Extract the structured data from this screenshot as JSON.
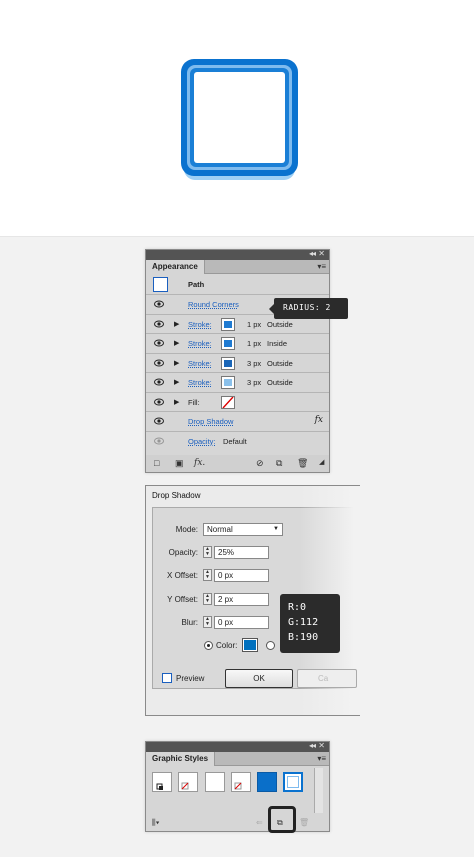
{
  "appearance": {
    "tab_title": "Appearance",
    "path_label": "Path",
    "rows": [
      {
        "label": "Round Corners",
        "kind": "effect"
      },
      {
        "label": "Stroke:",
        "weight": "1 px",
        "align": "Outside",
        "color": "#1f7ad1"
      },
      {
        "label": "Stroke:",
        "weight": "1 px",
        "align": "Inside",
        "color": "#1f7ad1"
      },
      {
        "label": "Stroke:",
        "weight": "3 px",
        "align": "Outside",
        "color": "#1a66b8"
      },
      {
        "label": "Stroke:",
        "weight": "3 px",
        "align": "Outside",
        "color": "#8ac0ea"
      },
      {
        "label": "Fill:",
        "kind": "fill-none"
      },
      {
        "label": "Drop Shadow",
        "kind": "effect",
        "fx": "fx"
      },
      {
        "label": "Opacity:",
        "value": "Default"
      }
    ],
    "toolbar_fx": "fx."
  },
  "radius_tooltip": "RADIUS: 2",
  "drop_shadow": {
    "title": "Drop Shadow",
    "mode_label": "Mode:",
    "mode_value": "Normal",
    "opacity_label": "Opacity:",
    "opacity_value": "25%",
    "x_offset_label": "X Offset:",
    "x_offset_value": "0 px",
    "y_offset_label": "Y Offset:",
    "y_offset_value": "2 px",
    "blur_label": "Blur:",
    "blur_value": "0 px",
    "color_label": "Color:",
    "shadow_color": "#0070be",
    "preview_label": "Preview",
    "ok_label": "OK",
    "cancel_label": "Ca"
  },
  "rgb_tooltip": {
    "r": "R:0",
    "g": "G:112",
    "b": "B:190"
  },
  "graphic_styles": {
    "tab_title": "Graphic Styles",
    "highlighted_icon": "new-graphic-style-icon"
  },
  "colors": {
    "accent": "#1a5fbf",
    "shape_blue": "#0a72cf",
    "shape_light": "#7fbbee"
  }
}
